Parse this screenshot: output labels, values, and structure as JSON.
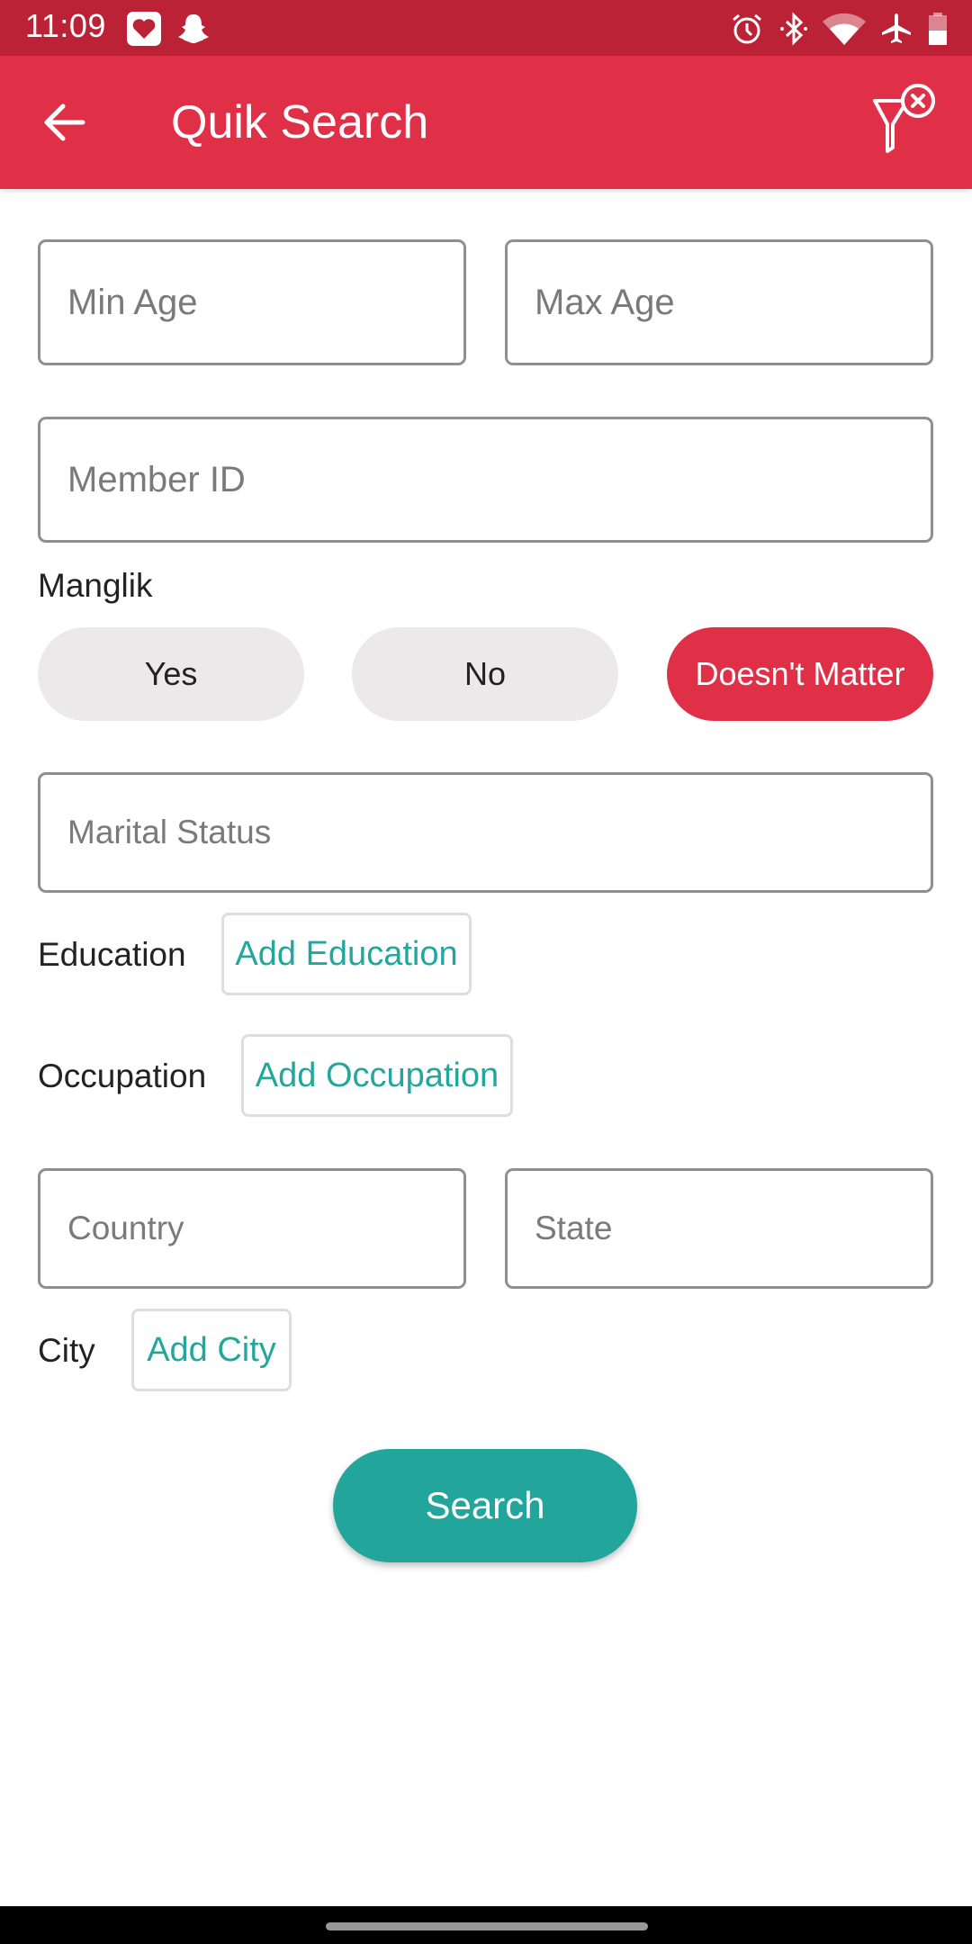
{
  "status_bar": {
    "time": "11:09",
    "left_icons": [
      "health-app-icon",
      "snapchat-icon"
    ],
    "right_icons": [
      "alarm-icon",
      "bluetooth-icon",
      "wifi-icon",
      "airplane-mode-icon",
      "battery-icon"
    ],
    "battery_level": 0.5
  },
  "app_bar": {
    "title": "Quik Search",
    "back_icon": "arrow-left-icon",
    "action_icon": "filter-clear-icon"
  },
  "form": {
    "min_age": {
      "placeholder": "Min Age",
      "value": ""
    },
    "max_age": {
      "placeholder": "Max Age",
      "value": ""
    },
    "member_id": {
      "placeholder": "Member ID",
      "value": ""
    },
    "manglik": {
      "label": "Manglik",
      "options": [
        {
          "label": "Yes",
          "selected": false
        },
        {
          "label": "No",
          "selected": false
        },
        {
          "label": "Doesn't Matter",
          "selected": true
        }
      ]
    },
    "marital_status": {
      "placeholder": "Marital Status",
      "value": ""
    },
    "education": {
      "label": "Education",
      "button": "Add Education"
    },
    "occupation": {
      "label": "Occupation",
      "button": "Add Occupation"
    },
    "country": {
      "placeholder": "Country",
      "value": ""
    },
    "state": {
      "placeholder": "State",
      "value": ""
    },
    "city": {
      "label": "City",
      "button": "Add City"
    },
    "search_button": "Search"
  },
  "colors": {
    "status_bar": "#bc2236",
    "primary": "#e03048",
    "accent": "#22a69b",
    "pill_inactive": "#ece9ea"
  }
}
